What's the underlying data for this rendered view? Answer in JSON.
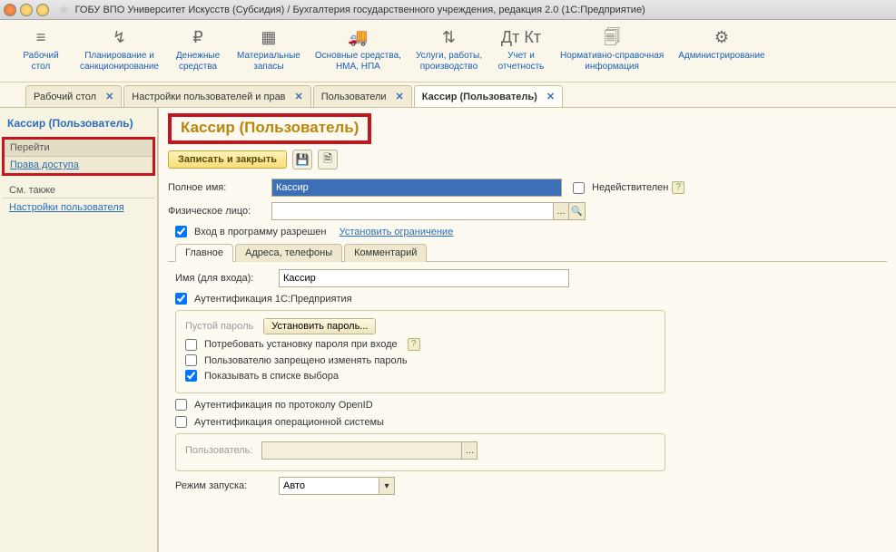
{
  "window": {
    "title": "ГОБУ ВПО Университет Искусств (Субсидия) / Бухгалтерия государственного учреждения, редакция 2.0  (1С:Предприятие)"
  },
  "toolbar": {
    "items": [
      {
        "icon": "≡",
        "label": "Рабочий\nстол"
      },
      {
        "icon": "↯",
        "label": "Планирование и\nсанкционирование"
      },
      {
        "icon": "₽",
        "label": "Денежные\nсредства"
      },
      {
        "icon": "▦",
        "label": "Материальные\nзапасы"
      },
      {
        "icon": "🚚",
        "label": "Основные средства,\nНМА, НПА"
      },
      {
        "icon": "⇅",
        "label": "Услуги, работы,\nпроизводство"
      },
      {
        "icon": "Дт Кт",
        "label": "Учет и\nотчетность"
      },
      {
        "icon": "🗐",
        "label": "Нормативно-справочная\nинформация"
      },
      {
        "icon": "⚙",
        "label": "Администрирование"
      }
    ]
  },
  "tabs": [
    {
      "label": "Рабочий стол",
      "active": false
    },
    {
      "label": "Настройки пользователей и прав",
      "active": false
    },
    {
      "label": "Пользователи",
      "active": false
    },
    {
      "label": "Кассир (Пользователь)",
      "active": true
    }
  ],
  "leftnav": {
    "title": "Кассир (Пользователь)",
    "group_header": "Перейти",
    "group_item": "Права доступа",
    "see_also": "См. также",
    "settings_link": "Настройки пользователя"
  },
  "page": {
    "title": "Кассир (Пользователь)",
    "save_close": "Записать и закрыть",
    "fullname_label": "Полное имя:",
    "fullname_value": "Кассир",
    "invalid_label": "Недействителен",
    "phys_label": "Физическое лицо:",
    "phys_value": "",
    "login_allowed": "Вход в программу разрешен",
    "set_restriction": "Установить ограничение",
    "subtabs": [
      "Главное",
      "Адреса, телефоны",
      "Комментарий"
    ],
    "login_name_label": "Имя (для входа):",
    "login_name_value": "Кассир",
    "auth1c": "Аутентификация 1С:Предприятия",
    "empty_pwd": "Пустой пароль",
    "set_pwd": "Установить пароль...",
    "require_pwd": "Потребовать установку пароля при входе",
    "deny_change": "Пользователю запрещено изменять пароль",
    "show_in_list": "Показывать в списке выбора",
    "auth_openid": "Аутентификация по протоколу OpenID",
    "auth_os": "Аутентификация операционной системы",
    "os_user_label": "Пользователь:",
    "os_user_value": "",
    "launch_mode_label": "Режим запуска:",
    "launch_mode_value": "Авто"
  }
}
